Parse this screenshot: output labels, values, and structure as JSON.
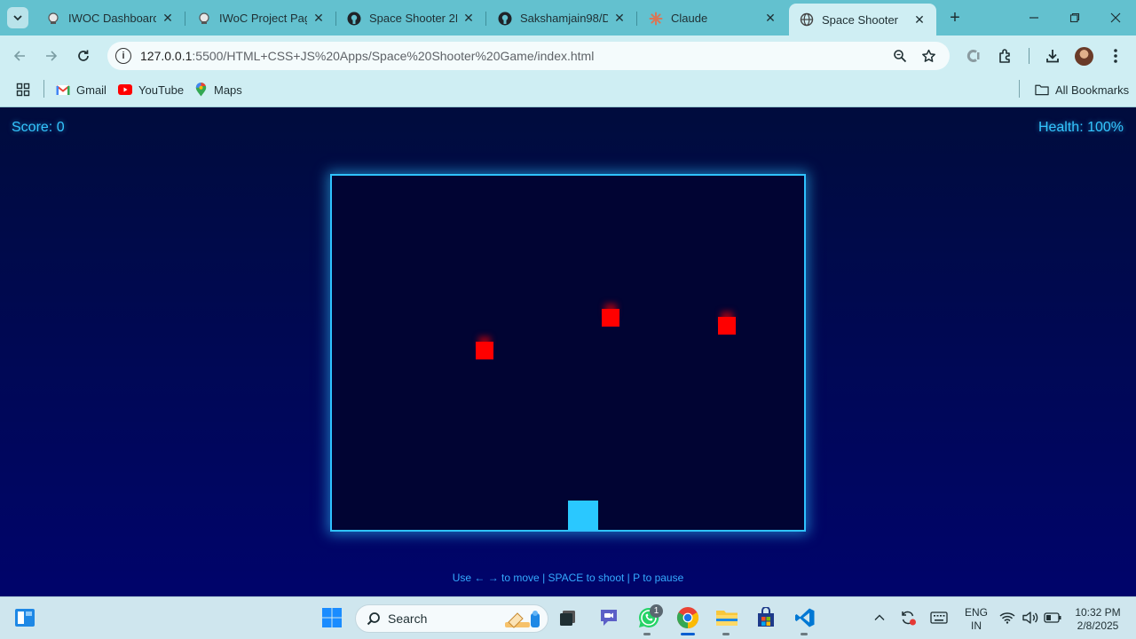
{
  "browser": {
    "tabs": [
      {
        "title": "IWOC Dashboard •",
        "icon": "web-icon",
        "active": false
      },
      {
        "title": "IWoC Project Page",
        "icon": "web-icon",
        "active": false
      },
      {
        "title": "Space Shooter 2D",
        "icon": "github-icon",
        "active": false
      },
      {
        "title": "Sakshamjain98/De",
        "icon": "github-icon",
        "active": false
      },
      {
        "title": "Claude",
        "icon": "claude-icon",
        "active": false
      },
      {
        "title": "Space Shooter",
        "icon": "globe-icon",
        "active": true
      }
    ],
    "url_host": "127.0.0.1",
    "url_rest": ":5500/HTML+CSS+JS%20Apps/Space%20Shooter%20Game/index.html",
    "bookmarks": [
      {
        "label": "Gmail",
        "icon": "gmail-icon"
      },
      {
        "label": "YouTube",
        "icon": "youtube-icon"
      },
      {
        "label": "Maps",
        "icon": "maps-icon"
      }
    ],
    "all_bookmarks_label": "All Bookmarks"
  },
  "game": {
    "score_text": "Score: 0",
    "health_text": "Health: 100%",
    "instructions": "Use ← → to move | SPACE to shoot | P to pause",
    "colors": {
      "accent": "#2fc2ff",
      "enemy": "#ff0000",
      "player": "#2ac8ff",
      "canvas_bg": "#010433"
    }
  },
  "taskbar": {
    "search_label": "Search",
    "whatsapp_badge": "1",
    "language_line1": "ENG",
    "language_line2": "IN",
    "time": "10:32 PM",
    "date": "2/8/2025"
  }
}
